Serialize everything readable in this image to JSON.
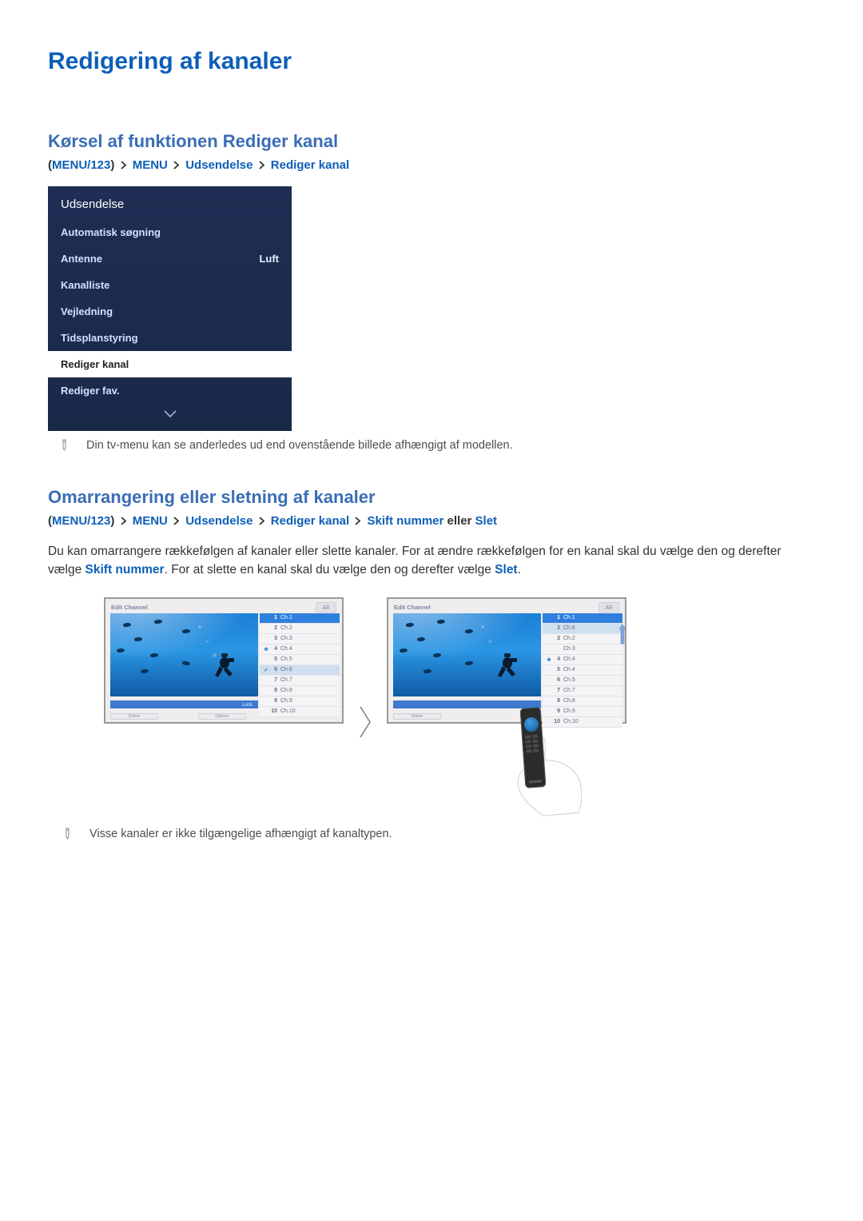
{
  "h1": "Redigering af kanaler",
  "s1": {
    "heading": "Kørsel af funktionen Rediger kanal",
    "breadcrumb": {
      "open": "(",
      "close": ")",
      "menu123": "MENU/123",
      "menu": "MENU",
      "udsendelse": "Udsendelse",
      "rediger": "Rediger kanal"
    },
    "menu": {
      "title": "Udsendelse",
      "items": [
        {
          "label": "Automatisk søgning",
          "value": "",
          "selected": false
        },
        {
          "label": "Antenne",
          "value": "Luft",
          "selected": false
        },
        {
          "label": "Kanalliste",
          "value": "",
          "selected": false
        },
        {
          "label": "Vejledning",
          "value": "",
          "selected": false
        },
        {
          "label": "Tidsplanstyring",
          "value": "",
          "selected": false
        },
        {
          "label": "Rediger kanal",
          "value": "",
          "selected": true
        },
        {
          "label": "Rediger fav.",
          "value": "",
          "selected": false
        }
      ]
    },
    "note": "Din tv-menu kan se anderledes ud end ovenstående billede afhængigt af modellen."
  },
  "s2": {
    "heading": "Omarrangering eller sletning af kanaler",
    "breadcrumb": {
      "open": "(",
      "close": ")",
      "menu123": "MENU/123",
      "menu": "MENU",
      "udsendelse": "Udsendelse",
      "rediger": "Rediger kanal",
      "skift": "Skift nummer",
      "eller": " eller ",
      "slet": "Slet"
    },
    "para_pre": "Du kan omarrangere rækkefølgen af kanaler eller slette kanaler. For at ændre rækkefølgen for en kanal skal du vælge den og derefter vælge ",
    "para_ref1": "Skift nummer",
    "para_mid": ". For at slette en kanal skal du vælge den og derefter vælge ",
    "para_ref2": "Slet",
    "para_end": ".",
    "screen": {
      "title": "Edit Channel",
      "tab": "All",
      "btn_delete": "Delete",
      "btn_options": "Options",
      "lock_label": "Lock"
    },
    "left_channels": [
      {
        "mark": "",
        "num": "1",
        "name": "Ch.1",
        "sel": true,
        "alt": false
      },
      {
        "mark": "",
        "num": "2",
        "name": "Ch.2",
        "sel": false,
        "alt": false
      },
      {
        "mark": "",
        "num": "3",
        "name": "Ch.3",
        "sel": false,
        "alt": false
      },
      {
        "mark": "★",
        "num": "4",
        "name": "Ch.4",
        "sel": false,
        "alt": false
      },
      {
        "mark": "",
        "num": "5",
        "name": "Ch.5",
        "sel": false,
        "alt": false
      },
      {
        "mark": "✓",
        "num": "6",
        "name": "Ch.6",
        "sel": false,
        "alt": true
      },
      {
        "mark": "",
        "num": "7",
        "name": "Ch.7",
        "sel": false,
        "alt": false
      },
      {
        "mark": "",
        "num": "8",
        "name": "Ch.8",
        "sel": false,
        "alt": false
      },
      {
        "mark": "",
        "num": "9",
        "name": "Ch.9",
        "sel": false,
        "alt": false
      },
      {
        "mark": "",
        "num": "10",
        "name": "Ch.10",
        "sel": false,
        "alt": false
      }
    ],
    "right_channels": [
      {
        "mark": "",
        "num": "1",
        "name": "Ch.1",
        "sel": true,
        "alt": false
      },
      {
        "mark": "",
        "num": "2",
        "name": "Ch.6",
        "sel": false,
        "alt": true
      },
      {
        "mark": "",
        "num": "3",
        "name": "Ch.2",
        "sel": false,
        "alt": false
      },
      {
        "mark": "",
        "num": "",
        "name": "Ch.3",
        "sel": false,
        "alt": false
      },
      {
        "mark": "★",
        "num": "4",
        "name": "Ch.4",
        "sel": false,
        "alt": false
      },
      {
        "mark": "",
        "num": "5",
        "name": "Ch.4",
        "sel": false,
        "alt": false
      },
      {
        "mark": "",
        "num": "6",
        "name": "Ch.5",
        "sel": false,
        "alt": false
      },
      {
        "mark": "",
        "num": "7",
        "name": "Ch.7",
        "sel": false,
        "alt": false
      },
      {
        "mark": "",
        "num": "8",
        "name": "Ch.8",
        "sel": false,
        "alt": false
      },
      {
        "mark": "",
        "num": "9",
        "name": "Ch.9",
        "sel": false,
        "alt": false
      },
      {
        "mark": "",
        "num": "10",
        "name": "Ch.10",
        "sel": false,
        "alt": false
      }
    ],
    "note": "Visse kanaler er ikke tilgængelige afhængigt af kanaltypen."
  }
}
